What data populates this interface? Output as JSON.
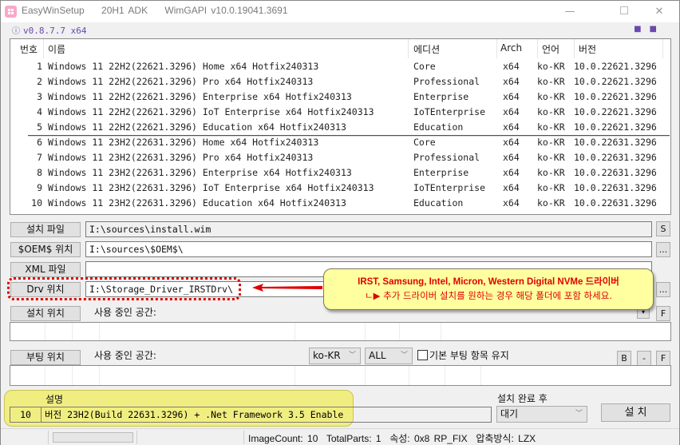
{
  "window": {
    "title": "EasyWinSetup    20H1 ADK    WimGAPI v10.0.19041.3691",
    "version": "v0.8.7.7 x64",
    "minimize": "—",
    "close": "✕",
    "dots": "■■"
  },
  "list": {
    "headers": {
      "no": "번호",
      "name": "이름",
      "edition": "에디션",
      "arch": "Arch",
      "lang": "언어",
      "version": "버전"
    },
    "rows": [
      {
        "no": "1",
        "name": "Windows 11 22H2(22621.3296) Home x64 Hotfix240313",
        "edition": "Core",
        "arch": "x64",
        "lang": "ko-KR",
        "version": "10.0.22621.3296"
      },
      {
        "no": "2",
        "name": "Windows 11 22H2(22621.3296) Pro x64 Hotfix240313",
        "edition": "Professional",
        "arch": "x64",
        "lang": "ko-KR",
        "version": "10.0.22621.3296"
      },
      {
        "no": "3",
        "name": "Windows 11 22H2(22621.3296) Enterprise x64 Hotfix240313",
        "edition": "Enterprise",
        "arch": "x64",
        "lang": "ko-KR",
        "version": "10.0.22621.3296"
      },
      {
        "no": "4",
        "name": "Windows 11 22H2(22621.3296) IoT Enterprise x64 Hotfix240313",
        "edition": "IoTEnterprise",
        "arch": "x64",
        "lang": "ko-KR",
        "version": "10.0.22621.3296"
      },
      {
        "no": "5",
        "name": "Windows 11 22H2(22621.3296) Education x64 Hotfix240313",
        "edition": "Education",
        "arch": "x64",
        "lang": "ko-KR",
        "version": "10.0.22621.3296"
      },
      {
        "no": "6",
        "name": "Windows 11 23H2(22631.3296) Home x64 Hotfix240313",
        "edition": "Core",
        "arch": "x64",
        "lang": "ko-KR",
        "version": "10.0.22631.3296"
      },
      {
        "no": "7",
        "name": "Windows 11 23H2(22631.3296) Pro x64 Hotfix240313",
        "edition": "Professional",
        "arch": "x64",
        "lang": "ko-KR",
        "version": "10.0.22631.3296"
      },
      {
        "no": "8",
        "name": "Windows 11 23H2(22631.3296) Enterprise x64 Hotfix240313",
        "edition": "Enterprise",
        "arch": "x64",
        "lang": "ko-KR",
        "version": "10.0.22631.3296"
      },
      {
        "no": "9",
        "name": "Windows 11 23H2(22631.3296) IoT Enterprise x64 Hotfix240313",
        "edition": "IoTEnterprise",
        "arch": "x64",
        "lang": "ko-KR",
        "version": "10.0.22631.3296"
      },
      {
        "no": "10",
        "name": "Windows 11 23H2(22631.3296) Education x64 Hotfix240313",
        "edition": "Education",
        "arch": "x64",
        "lang": "ko-KR",
        "version": "10.0.22631.3296"
      }
    ]
  },
  "paths": {
    "install_file": {
      "label": "설치 파일",
      "value": "I:\\sources\\install.wim",
      "side_button": "S"
    },
    "oem": {
      "label": "$OEM$ 위치",
      "value": "I:\\sources\\$OEM$\\",
      "side_button": "..."
    },
    "xml": {
      "label": "XML 파일",
      "value": ""
    },
    "drv": {
      "label": "Drv 위치",
      "value": "I:\\Storage_Driver_IRSTDrv\\",
      "side_button": "..."
    }
  },
  "install_location": {
    "label": "설치 위치",
    "space_label": "사용 중인 공간:",
    "side_button": "F",
    "dropdown": "▾"
  },
  "boot_location": {
    "label": "부팅 위치",
    "space_label": "사용 중인 공간:",
    "lang_select": "ko-KR",
    "filter_select": "ALL",
    "keep_default_label": "기본 부팅 항목 유지",
    "keep_default_checked": false,
    "btn_b": "B",
    "btn_minus": "-",
    "btn_f": "F"
  },
  "callout": {
    "line1": "IRST, Samsung, Intel, Micron, Western Digital NVMe 드라이버",
    "line2": "ㄴ▶ 추가 드라이버 설치를 원하는 경우 해당 폴더에 포함 하세요."
  },
  "description": {
    "title": "설명",
    "index": "10",
    "text": "버전 23H2(Build 22631.3296) + .Net Framework 3.5 Enable"
  },
  "after_install": {
    "label": "설치 완료 후",
    "selected": "대기"
  },
  "install_button": "설 치",
  "status": {
    "text": "ImageCount: 10  TotalParts: 1  속성: 0x8 RP_FIX  압축방식: LZX"
  },
  "colors": {
    "accent": "#6a48b0",
    "callout_bg": "#ffffa0",
    "callout_text": "#e00000",
    "highlight": "#f2ee7c"
  }
}
